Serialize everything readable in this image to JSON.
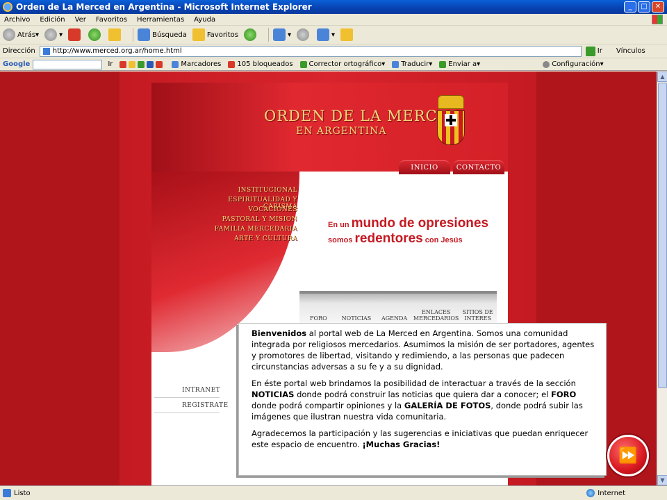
{
  "window": {
    "title": "Orden de La Merced en Argentina - Microsoft Internet Explorer"
  },
  "menu": [
    "Archivo",
    "Edición",
    "Ver",
    "Favoritos",
    "Herramientas",
    "Ayuda"
  ],
  "toolbar": {
    "back": "Atrás",
    "search": "Búsqueda",
    "favorites": "Favoritos"
  },
  "address": {
    "label": "Dirección",
    "url": "http://www.merced.org.ar/home.html",
    "go": "Ir",
    "links": "Vínculos"
  },
  "googlebar": {
    "logo": "Google",
    "go": "Ir",
    "bookmarks": "Marcadores",
    "blocked": "105 bloqueados",
    "spell": "Corrector ortográfico",
    "translate": "Traducir",
    "send": "Enviar a",
    "settings": "Configuración"
  },
  "site": {
    "logo_line1": "ORDEN DE LA MERCED",
    "logo_line2": "EN ARGENTINA",
    "topnav": [
      "INICIO",
      "CONTACTO"
    ],
    "leftmenu": [
      "INSTITUCIONAL",
      "ESPIRITUALIDAD Y CARISMA",
      "VOCACIONES",
      "PASTORAL Y MISION",
      "FAMILIA MERCEDARIA",
      "ARTE Y CULTURA"
    ],
    "slogan": {
      "l1a": "En un",
      "l1b": "mundo de opresiones",
      "l2a": "somos",
      "l2b": "redentores",
      "l2c": "con Jesús"
    },
    "subnav": [
      "FORO",
      "NOTICIAS",
      "AGENDA",
      "ENLACES MERCEDARIOS",
      "SITIOS DE INTERES"
    ],
    "side_links": [
      "INTRANET",
      "REGISTRATE"
    ]
  },
  "welcome": {
    "p1_bold": "Bienvenidos",
    "p1_rest": " al portal web de La Merced en Argentina. Somos una comunidad integrada por religiosos mercedarios. Asumimos la misión de ser portadores, agentes y promotores de libertad, visitando y redimiendo, a las personas que padecen circunstancias adversas a su fe y a su dignidad.",
    "p2_a": "En éste portal web brindamos la posibilidad de interactuar a través de la sección ",
    "p2_b": "NOTICIAS",
    "p2_c": " donde podrá construir las noticias que quiera dar a conocer; el ",
    "p2_d": "FORO",
    "p2_e": " donde podrá compartir opiniones y la ",
    "p2_f": "GALERÍA DE FOTOS",
    "p2_g": ", donde podrá subir las imágenes que ilustran nuestra vida comunitaria.",
    "p3_a": "Agradecemos la participación y las sugerencias e iniciativas que puedan enriquecer este espacio de encuentro. ",
    "p3_b": "¡Muchas Gracias!"
  },
  "status": {
    "text": "Listo",
    "zone": "Internet"
  }
}
